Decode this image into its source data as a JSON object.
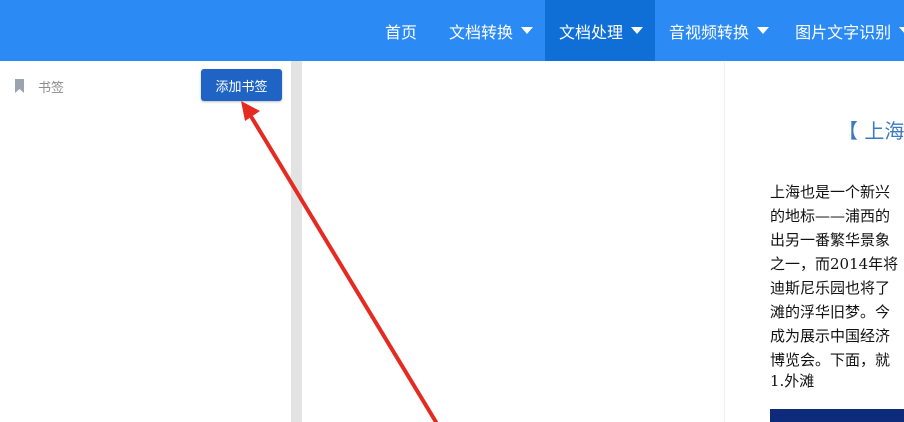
{
  "nav": {
    "items": [
      {
        "label": "首页"
      },
      {
        "label": "文档转换"
      },
      {
        "label": "文档处理"
      },
      {
        "label": "音视频转换"
      },
      {
        "label": "图片文字识别"
      }
    ]
  },
  "sidebar": {
    "bookmark_label": "书签",
    "add_button_label": "添加书签"
  },
  "document": {
    "title_visible": "【 上海",
    "paragraph_lines": [
      "上海也是一个新兴",
      "的地标——浦西的",
      "出另一番繁华景象",
      "之一，而2014年将",
      "迪斯尼乐园也将了",
      "滩的浮华旧梦。今",
      "成为展示中国经济",
      "博览会。下面，就"
    ],
    "section_heading": "1.外滩"
  },
  "colors": {
    "topbar": "#2b8af3",
    "nav_active": "#0f6fd6",
    "button": "#1f64c4",
    "annotation_arrow": "#e52a22"
  },
  "icons": {
    "bookmark": "bookmark-icon",
    "dropdown": "chevron-down-icon"
  }
}
